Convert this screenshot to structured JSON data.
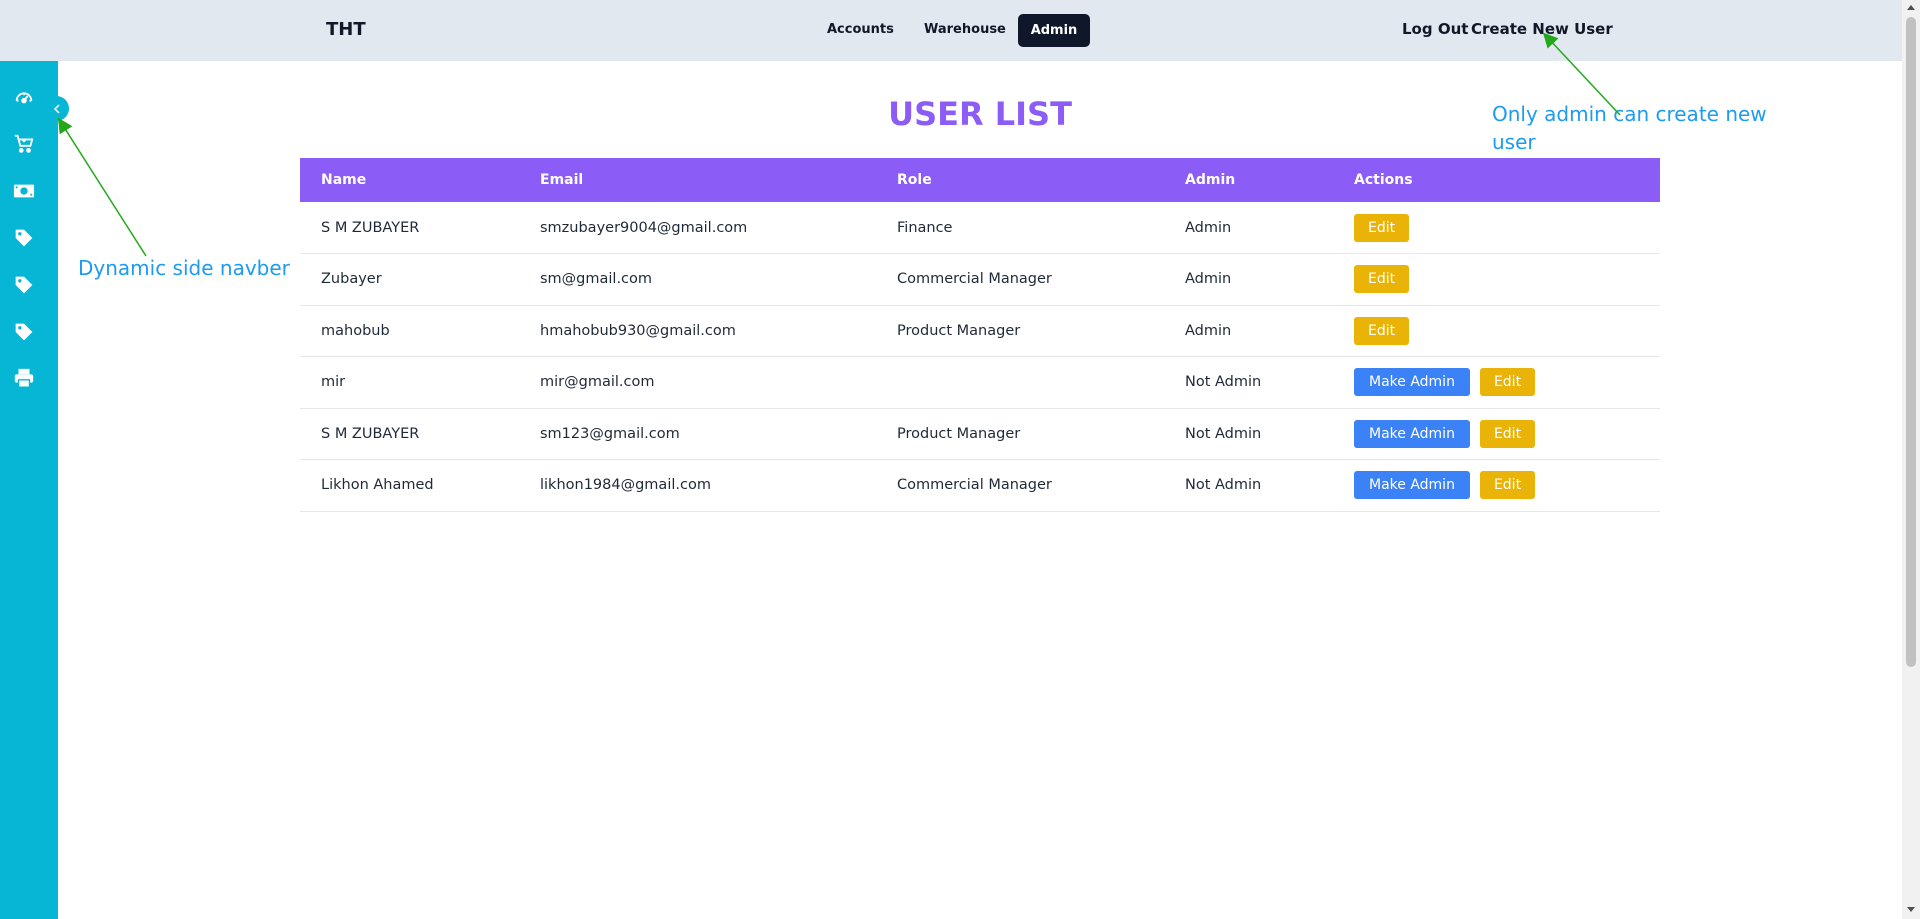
{
  "header": {
    "brand": "THT",
    "nav": [
      "Accounts",
      "Warehouse"
    ],
    "active_nav": "Admin",
    "logout": "Log Out",
    "create_user": "Create New User"
  },
  "sidebar": {
    "icons": [
      "dashboard-icon",
      "cart-icon",
      "money-icon",
      "tag-icon",
      "tag-icon",
      "tag-icon",
      "printer-icon"
    ],
    "collapse_icon": "chevron-left-icon"
  },
  "main": {
    "title": "USER LIST",
    "columns": [
      "Name",
      "Email",
      "Role",
      "Admin",
      "Actions"
    ],
    "make_admin_label": "Make Admin",
    "edit_label": "Edit",
    "rows": [
      {
        "name": "S M ZUBAYER",
        "email": "smzubayer9004@gmail.com",
        "role": "Finance",
        "admin": "Admin"
      },
      {
        "name": "Zubayer",
        "email": "sm@gmail.com",
        "role": "Commercial Manager",
        "admin": "Admin"
      },
      {
        "name": "mahobub",
        "email": "hmahobub930@gmail.com",
        "role": "Product Manager",
        "admin": "Admin"
      },
      {
        "name": "mir",
        "email": "mir@gmail.com",
        "role": "",
        "admin": "Not Admin"
      },
      {
        "name": "S M ZUBAYER",
        "email": "sm123@gmail.com",
        "role": "Product Manager",
        "admin": "Not Admin"
      },
      {
        "name": "Likhon Ahamed",
        "email": "likhon1984@gmail.com",
        "role": "Commercial Manager",
        "admin": "Not Admin"
      }
    ]
  },
  "annotations": {
    "sidebar_note": "Dynamic side navber",
    "create_note_line1": "Only admin can create new",
    "create_note_line2": "user"
  },
  "colors": {
    "topbar": "#e2e8f0",
    "sidebar": "#06b6d4",
    "accent_purple": "#8b5cf6",
    "button_blue": "#3b82f6",
    "button_yellow": "#eab308",
    "annotation_blue": "#1d9bf0",
    "arrow_green": "#22a81a"
  }
}
